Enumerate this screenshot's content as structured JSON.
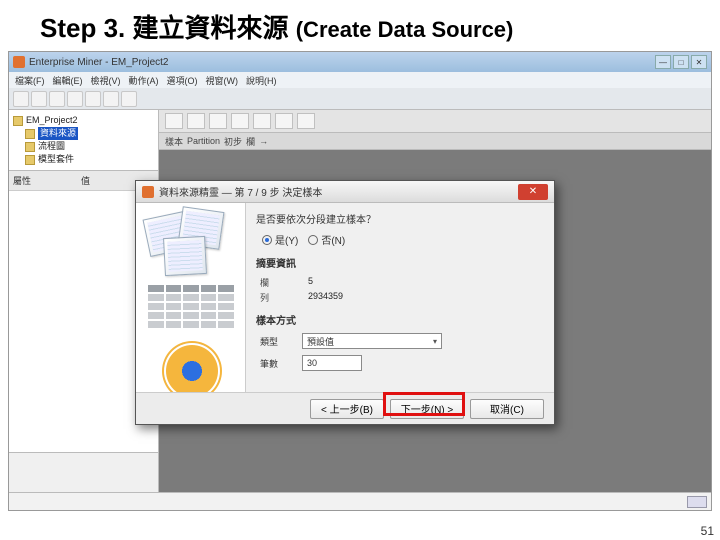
{
  "slide": {
    "step_prefix": "Step 3. ",
    "title_cjk": "建立資料來源",
    "title_en": "(Create Data Source)",
    "page_number": "51"
  },
  "window": {
    "title": "Enterprise Miner - EM_Project2",
    "menus": [
      "檔案(F)",
      "編輯(E)",
      "檢視(V)",
      "動作(A)",
      "選項(O)",
      "視窗(W)",
      "說明(H)"
    ],
    "tree": {
      "root": "EM_Project2",
      "nodes": [
        "資料來源",
        "流程圖",
        "模型套件"
      ],
      "selected": "資料來源"
    },
    "prop_header_left": "屬性",
    "prop_header_right": "值",
    "main_tabs": [
      "樣本",
      "Partition",
      "初步",
      "欄",
      "→"
    ]
  },
  "wizard": {
    "title": "資料來源精靈 — 第 7 / 9 步 決定樣本",
    "question": "是否要依次分段建立樣本？",
    "radio_yes": "是(Y)",
    "radio_no": "否(N)",
    "section_summary": "摘要資訊",
    "rows_label": "欄",
    "rows_value": "5",
    "cols_label": "列",
    "cols_value": "2934359",
    "section_sample": "樣本方式",
    "type_label": "類型",
    "type_value": "預設值",
    "size_label": "筆數",
    "size_value": "30",
    "btn_back": "< 上一步(B)",
    "btn_next": "下一步(N) >",
    "btn_cancel": "取消(C)"
  }
}
